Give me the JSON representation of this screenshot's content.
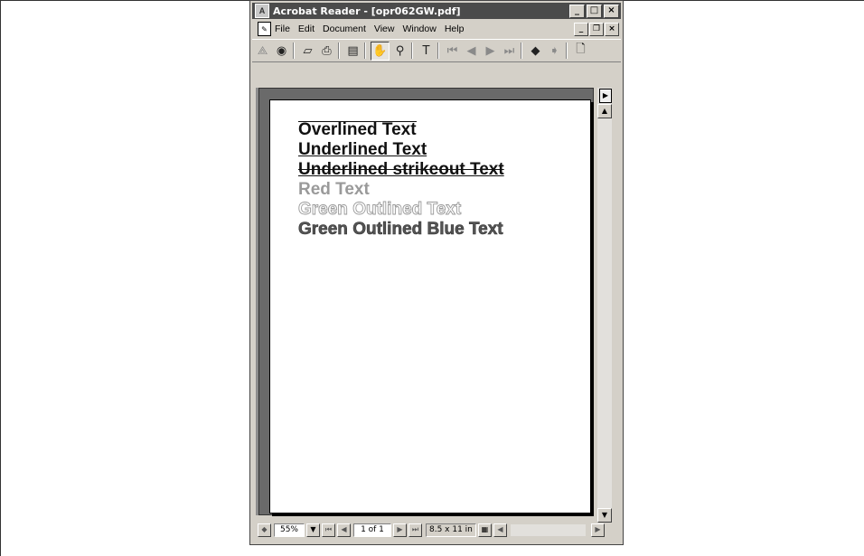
{
  "window": {
    "title": "Acrobat Reader - [opr062GW.pdf]",
    "caption_buttons": {
      "minimize": "_",
      "restore": "□",
      "close": "×"
    }
  },
  "menubar": {
    "items": [
      "File",
      "Edit",
      "Document",
      "View",
      "Window",
      "Help"
    ],
    "mdi_buttons": {
      "minimize": "_",
      "restore": "❐",
      "close": "×"
    }
  },
  "toolbar": {
    "icons": [
      {
        "name": "acrobat-logo-icon",
        "glyph": "⟁",
        "disabled": true
      },
      {
        "name": "web-search-icon",
        "glyph": "◉"
      },
      {
        "name": "open-folder-icon",
        "glyph": "▱"
      },
      {
        "name": "print-icon",
        "glyph": "⎙"
      },
      {
        "name": "show-navigation-pane-icon",
        "glyph": "▤"
      },
      {
        "name": "hand-tool-icon",
        "glyph": "✋",
        "pressed": true
      },
      {
        "name": "zoom-tool-icon",
        "glyph": "⚲"
      },
      {
        "name": "text-select-tool-icon",
        "glyph": "T"
      },
      {
        "name": "first-page-icon",
        "glyph": "⏮",
        "disabled": true
      },
      {
        "name": "previous-page-icon",
        "glyph": "◀",
        "disabled": true
      },
      {
        "name": "next-page-icon",
        "glyph": "▶",
        "disabled": true
      },
      {
        "name": "last-page-icon",
        "glyph": "⏭",
        "disabled": true
      },
      {
        "name": "go-back-icon",
        "glyph": "◆"
      },
      {
        "name": "go-forward-icon",
        "glyph": "➧",
        "disabled": true
      },
      {
        "name": "actual-size-icon",
        "glyph": "🗋"
      }
    ]
  },
  "document": {
    "lines": [
      "Overlined Text",
      "Underlined Text",
      "Underlined strikeout Text",
      "Red Text",
      "Green Outlined Text",
      "Green Outlined Blue Text"
    ]
  },
  "statusbar": {
    "zoom": "55%",
    "page": "1 of 1",
    "page_size": "8.5 x 11 in"
  },
  "colors": {
    "title_bar": "#4b4b4b",
    "chrome": "#d4d0c8",
    "doc_background": "#6a6a6a"
  }
}
